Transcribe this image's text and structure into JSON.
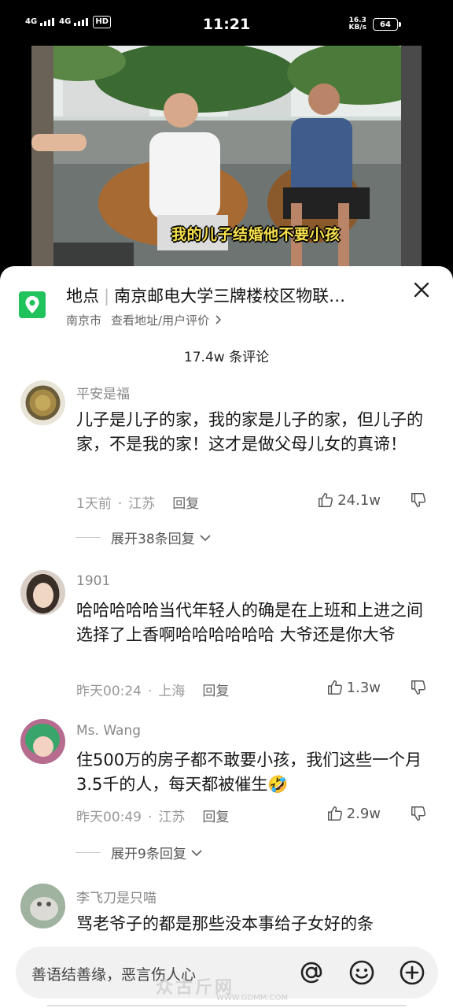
{
  "status_bar": {
    "signal1": "4G",
    "signal2": "4G",
    "hd": "HD",
    "time": "11:21",
    "speed_value": "16.3",
    "speed_unit": "KB/s",
    "battery": "64"
  },
  "video": {
    "subtitle": "我的儿子结婚他不要小孩"
  },
  "location": {
    "label": "地点",
    "name": "南京邮电大学三牌楼校区物联…",
    "city": "南京市",
    "link": "查看地址/用户评价",
    "icon": "location-pin-icon",
    "accent": "#20c25c"
  },
  "comments_count": "17.4w 条评论",
  "comments": [
    {
      "user": "平安是福",
      "text": "儿子是儿子的家，我的家是儿子的家，但儿子的家，不是我的家！这才是做父母儿女的真谛！",
      "time": "1天前",
      "region": "江苏",
      "reply": "回复",
      "likes": "24.1w",
      "expand": "展开38条回复"
    },
    {
      "user": "1901",
      "text": "哈哈哈哈哈当代年轻人的确是在上班和上进之间选择了上香啊哈哈哈哈哈哈 大爷还是你大爷",
      "time": "昨天00:24",
      "region": "上海",
      "reply": "回复",
      "likes": "1.3w"
    },
    {
      "user": "Ms. Wang",
      "text": "住500万的房子都不敢要小孩，我们这些一个月3.5千的人，每天都被催生",
      "emoji": "🤣",
      "time": "昨天00:49",
      "region": "江苏",
      "reply": "回复",
      "likes": "2.9w",
      "expand": "展开9条回复"
    },
    {
      "user": "李飞刀是只喵",
      "text": "骂老爷子的都是那些没本事给子女好的条"
    }
  ],
  "input": {
    "placeholder": "善语结善缘，恶言伤人心"
  },
  "watermark": {
    "text": "众古斤网",
    "url": "WWW.GDMM.COM"
  }
}
